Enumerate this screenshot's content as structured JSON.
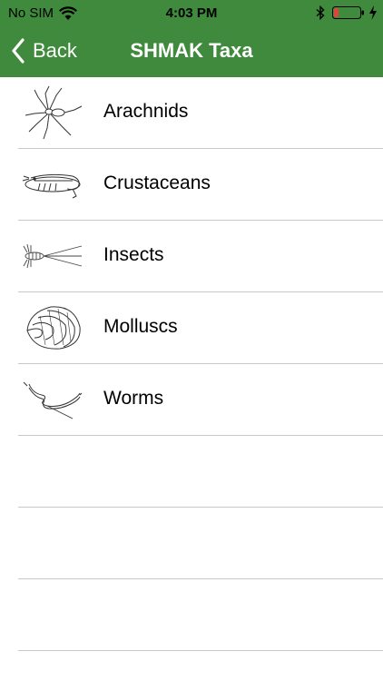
{
  "status_bar": {
    "carrier": "No SIM",
    "time": "4:03 PM",
    "battery_color": "#e0433a",
    "wifi_icon": "wifi-icon",
    "bluetooth_icon": "bluetooth-icon",
    "battery_icon": "battery-icon",
    "charging_icon": "charging-bolt-icon"
  },
  "nav": {
    "back_label": "Back",
    "title": "SHMAK Taxa",
    "bar_color": "#3f8a3c"
  },
  "taxa": [
    {
      "label": "Arachnids",
      "icon": "spider-icon"
    },
    {
      "label": "Crustaceans",
      "icon": "shrimp-icon"
    },
    {
      "label": "Insects",
      "icon": "insect-larva-icon"
    },
    {
      "label": "Molluscs",
      "icon": "snail-shell-icon"
    },
    {
      "label": "Worms",
      "icon": "worm-icon"
    }
  ]
}
